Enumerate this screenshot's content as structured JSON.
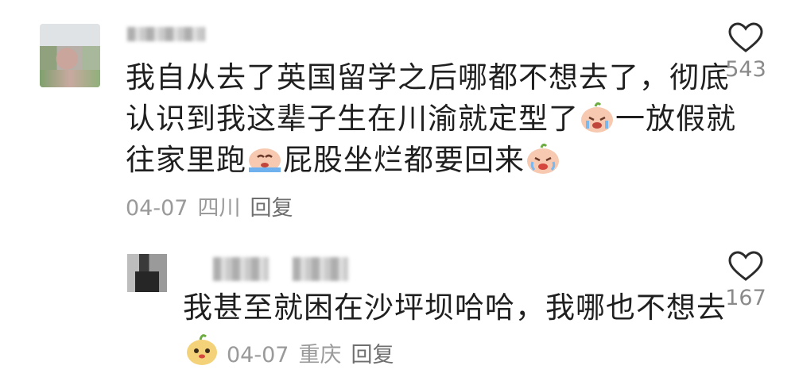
{
  "comments": [
    {
      "text_line1": "我自从去了英国留学之后哪都不想去了，彻底",
      "text_line2_a": "认识到我这辈子生在川渝就定型了",
      "text_line2_b": "一放假就",
      "text_line3_a": "往家里跑",
      "text_line3_b": "屁股坐烂都要回来",
      "date": "04-07",
      "location": "四川",
      "reply_label": "回复",
      "likes": "543",
      "emojis": [
        "crying-face-icon",
        "crying-face-icon",
        "crying-face-icon"
      ]
    },
    {
      "text": "我甚至就困在沙坪坝哈哈，我哪也不想去",
      "date": "04-07",
      "location": "重庆",
      "reply_label": "回复",
      "likes": "167",
      "badge_icon": "mascot-icon"
    }
  ],
  "colors": {
    "text": "#1f1f1f",
    "meta": "#9a9a9a",
    "like_outline": "#2b2b2b"
  }
}
